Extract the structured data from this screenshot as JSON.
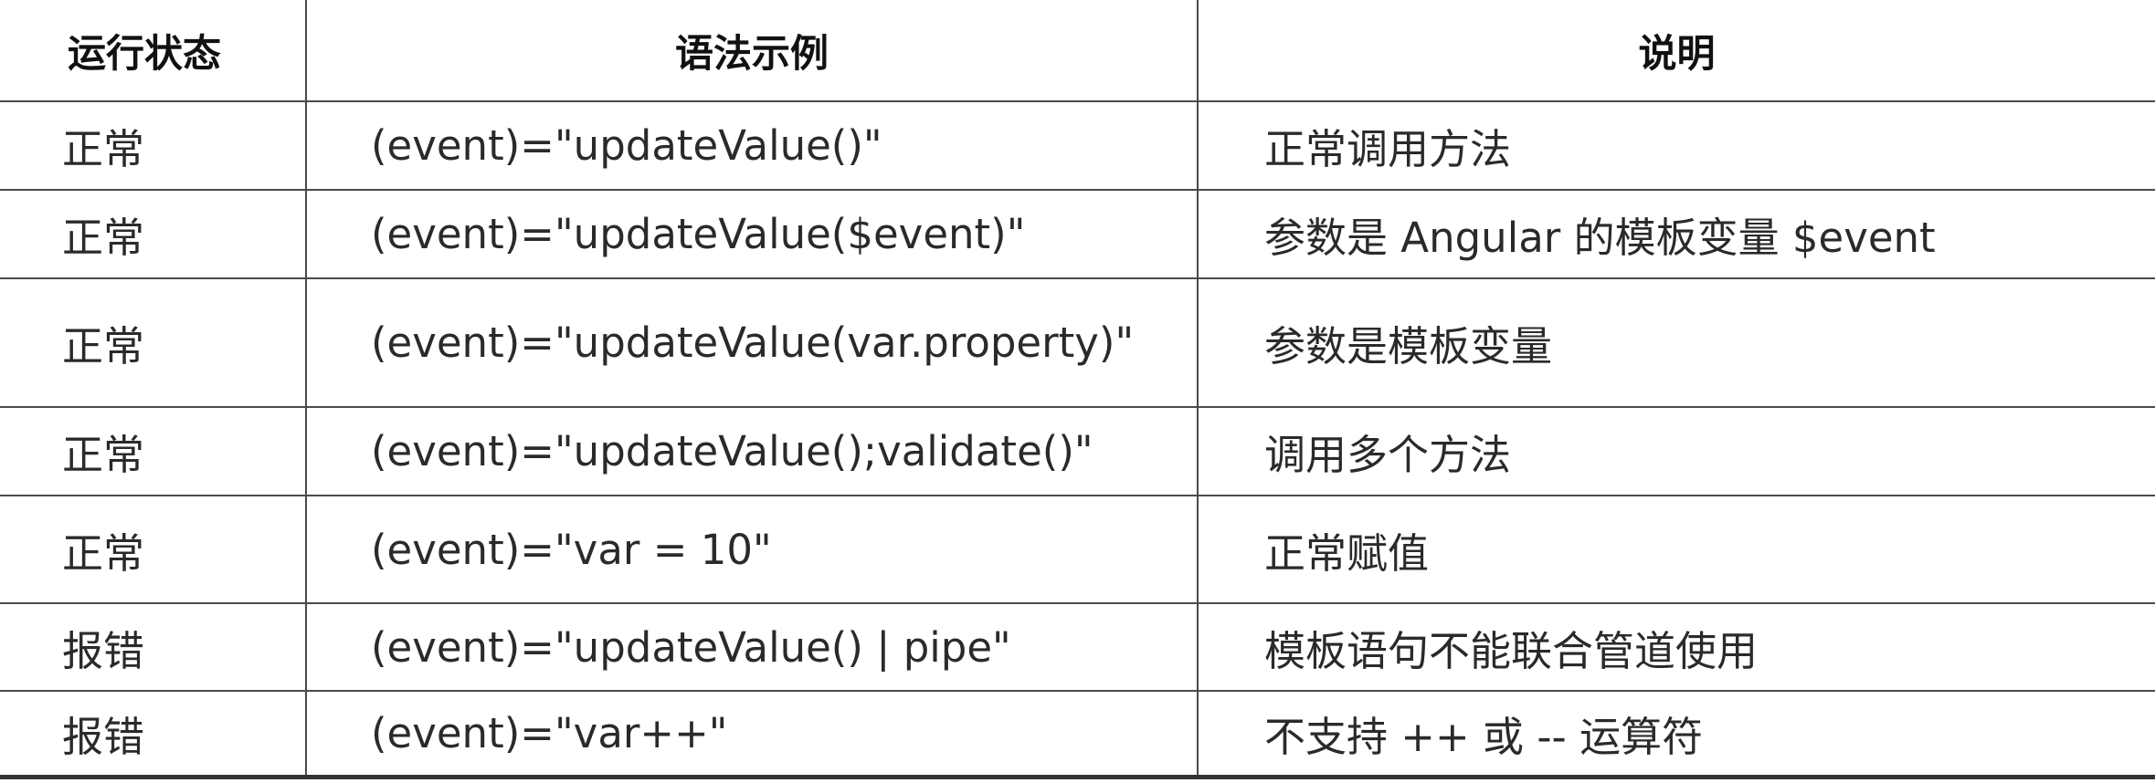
{
  "table": {
    "headers": {
      "status": "运行状态",
      "syntax": "语法示例",
      "description": "说明"
    },
    "rows": [
      {
        "status": "正常",
        "syntax": "(event)=\"updateValue()\"",
        "description": "正常调用方法"
      },
      {
        "status": "正常",
        "syntax": "(event)=\"updateValue($event)\"",
        "description": "参数是 Angular 的模板变量 $event"
      },
      {
        "status": "正常",
        "syntax": "(event)=\"updateValue(var.property)\"",
        "description": "参数是模板变量"
      },
      {
        "status": "正常",
        "syntax": "(event)=\"updateValue();validate()\"",
        "description": "调用多个方法"
      },
      {
        "status": "正常",
        "syntax": "(event)=\"var = 10\"",
        "description": "正常赋值"
      },
      {
        "status": "报错",
        "syntax": "(event)=\"updateValue() | pipe\"",
        "description": "模板语句不能联合管道使用"
      },
      {
        "status": "报错",
        "syntax": "(event)=\"var++\"",
        "description": "不支持 ++ 或 -- 运算符"
      }
    ]
  }
}
